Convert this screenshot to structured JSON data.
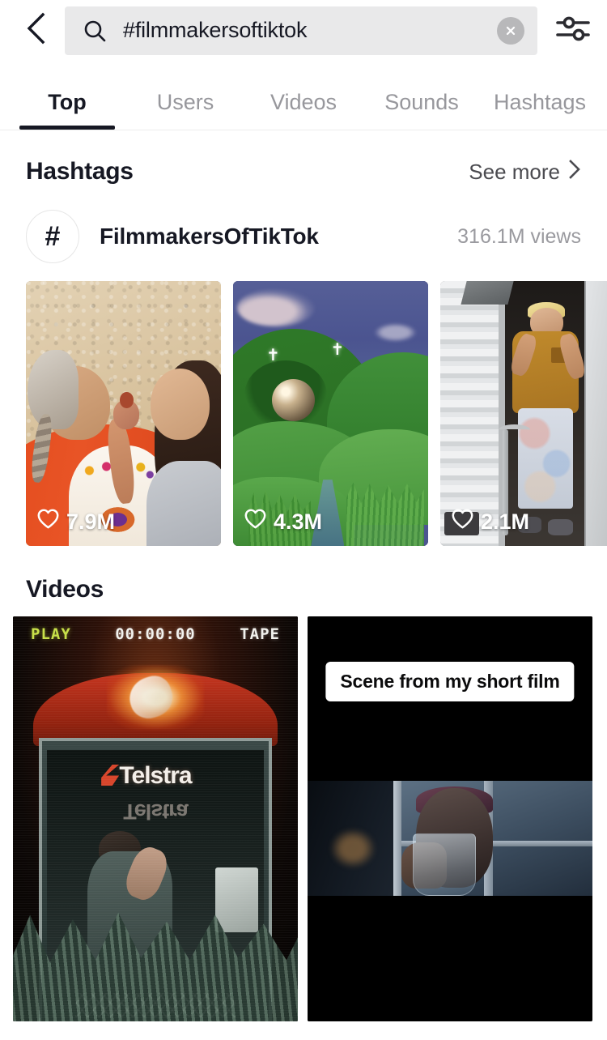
{
  "topbar": {
    "back_icon": "chevron-left-icon",
    "search_icon": "search-icon",
    "search_value": "#filmmakersoftiktok",
    "search_placeholder": "Search",
    "clear_icon": "close-circle-icon",
    "filter_icon": "filter-sliders-icon"
  },
  "tabs": [
    {
      "label": "Top",
      "active": true
    },
    {
      "label": "Users",
      "active": false
    },
    {
      "label": "Videos",
      "active": false
    },
    {
      "label": "Sounds",
      "active": false
    },
    {
      "label": "Hashtags",
      "active": false
    }
  ],
  "hashtags_section": {
    "title": "Hashtags",
    "see_more_label": "See more",
    "see_more_icon": "chevron-right-icon",
    "item": {
      "hash_glyph": "#",
      "name": "FilmmakersOfTikTok",
      "views": "316.1M views"
    }
  },
  "thumbnails": [
    {
      "art": "abuela",
      "likes": "7.9M",
      "like_icon": "heart-icon"
    },
    {
      "art": "hills",
      "likes": "4.3M",
      "like_icon": "heart-icon"
    },
    {
      "art": "trailer",
      "likes": "2.1M",
      "like_icon": "heart-icon"
    }
  ],
  "videos_section": {
    "title": "Videos",
    "items": [
      {
        "art": "telstra",
        "vhs_play": "PLAY",
        "vhs_time": "00:00:00",
        "vhs_tape": "TAPE",
        "logo": "Telstra",
        "caption": ""
      },
      {
        "art": "film",
        "caption": "Scene from my short film"
      }
    ]
  },
  "colors": {
    "text_primary": "#161823",
    "text_muted": "#97979c",
    "search_bg": "#e9e9ea",
    "accent_underline": "#161823",
    "vhs_play_green": "#c8e04a"
  }
}
